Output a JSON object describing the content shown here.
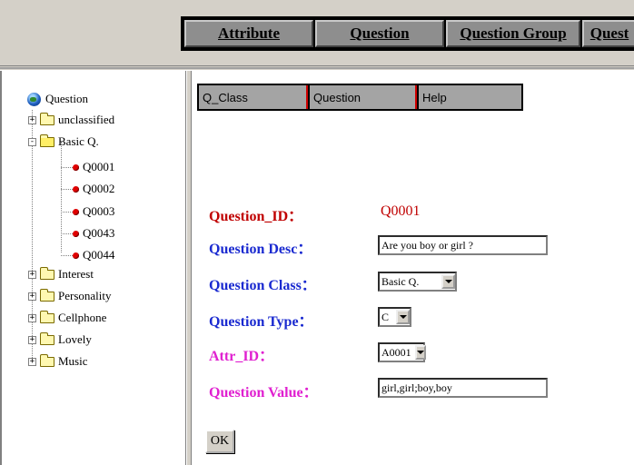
{
  "top_nav": {
    "tabs": [
      "Attribute",
      "Question",
      "Question Group",
      "Quest"
    ]
  },
  "tree": {
    "root": "Question",
    "nodes": [
      {
        "label": "unclassified",
        "type": "folder",
        "expander": "+"
      },
      {
        "label": "Basic Q.",
        "type": "folder",
        "expander": "-",
        "open": true
      },
      {
        "label": "Q0001",
        "type": "leaf"
      },
      {
        "label": "Q0002",
        "type": "leaf"
      },
      {
        "label": "Q0003",
        "type": "leaf"
      },
      {
        "label": "Q0043",
        "type": "leaf"
      },
      {
        "label": "Q0044",
        "type": "leaf"
      },
      {
        "label": "Interest",
        "type": "folder",
        "expander": "+"
      },
      {
        "label": "Personality",
        "type": "folder",
        "expander": "+"
      },
      {
        "label": "Cellphone",
        "type": "folder",
        "expander": "+"
      },
      {
        "label": "Lovely",
        "type": "folder",
        "expander": "+"
      },
      {
        "label": "Music",
        "type": "folder",
        "expander": "+"
      }
    ]
  },
  "sub_nav": {
    "tabs": [
      "Q_Class",
      "Question",
      "Help"
    ]
  },
  "form": {
    "question_id_label": "Question_ID：",
    "question_id_value": "Q0001",
    "question_desc_label": "Question Desc：",
    "question_desc_value": "Are you boy or girl ?",
    "question_class_label": "Question Class：",
    "question_class_value": "Basic Q.",
    "question_type_label": "Question Type：",
    "question_type_value": "C",
    "attr_id_label": "Attr_ID：",
    "attr_id_value": "A0001",
    "question_value_label": "Question Value：",
    "question_value_value": "girl,girl;boy,boy",
    "ok_label": "OK"
  },
  "colors": {
    "label_red": "#c00000",
    "label_blue": "#1a2ad0",
    "label_magenta": "#e020d0"
  }
}
